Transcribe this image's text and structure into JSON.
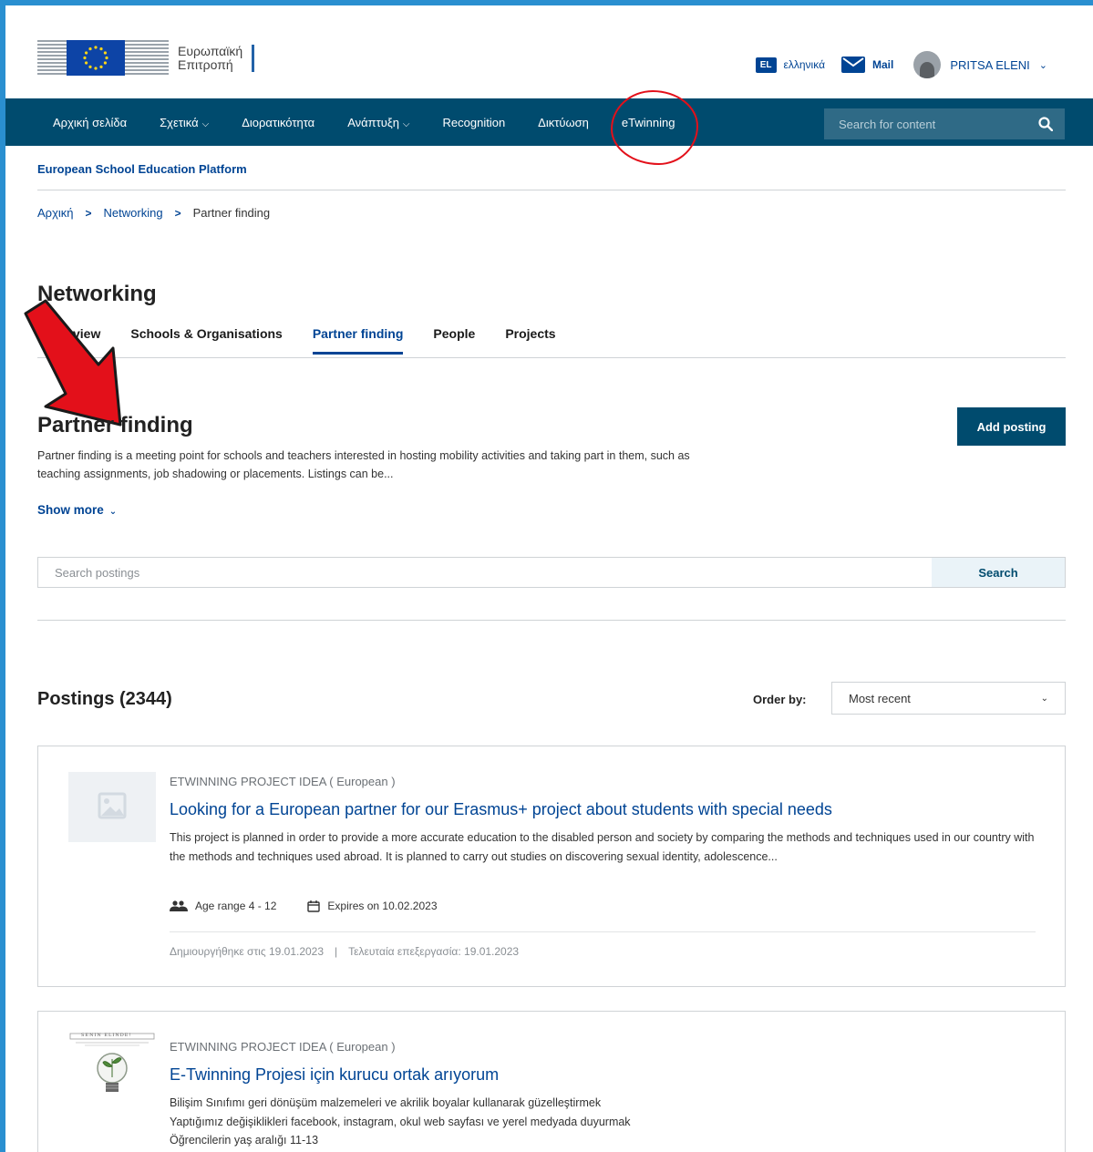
{
  "header": {
    "logo_line1": "Ευρωπαϊκή",
    "logo_line2": "Επιτροπή",
    "lang_code": "EL",
    "lang_label": "ελληνικά",
    "mail_label": "Mail",
    "user_name": "PRITSA ELENI"
  },
  "nav": {
    "items": [
      {
        "label": "Αρχική σελίδα",
        "dropdown": false
      },
      {
        "label": "Σχετικά",
        "dropdown": true
      },
      {
        "label": "Διορατικότητα",
        "dropdown": false
      },
      {
        "label": "Ανάπτυξη",
        "dropdown": true
      },
      {
        "label": "Recognition",
        "dropdown": false
      },
      {
        "label": "Δικτύωση",
        "dropdown": false
      },
      {
        "label": "eTwinning",
        "dropdown": false
      }
    ],
    "search_placeholder": "Search for content"
  },
  "platform_title": "European School Education Platform",
  "breadcrumb": [
    "Αρχική",
    "Networking",
    "Partner finding"
  ],
  "section": {
    "title": "Networking",
    "tabs": [
      "Overview",
      "Schools & Organisations",
      "Partner finding",
      "People",
      "Projects"
    ],
    "tab_visible_text": [
      "view",
      "Schools & Organisations",
      "Partner finding",
      "People",
      "Projects"
    ],
    "active_tab": "Partner finding"
  },
  "partner_finding": {
    "title": "Partner finding",
    "add_button": "Add posting",
    "description": "Partner finding is a meeting point for schools and teachers interested in hosting mobility activities and taking part in them, such as teaching assignments, job shadowing or placements. Listings can be...",
    "show_more": "Show more",
    "search_placeholder": "Search postings",
    "search_button": "Search"
  },
  "postings": {
    "title": "Postings (2344)",
    "order_label": "Order by:",
    "order_value": "Most recent",
    "items": [
      {
        "type": "ETWINNING PROJECT IDEA ( European )",
        "title": "Looking for a European partner for our Erasmus+ project about students with special needs",
        "body": "This project is planned in order to provide a more accurate education to the disabled person and society by comparing the methods and techniques used in our country with the methods and techniques used abroad. It is planned to carry out studies on discovering sexual identity, adolescence...",
        "age_range": "Age range 4 - 12",
        "expires": "Expires on 10.02.2023",
        "created": "Δημιουργήθηκε στις 19.01.2023",
        "edited": "Τελευταία επεξεργασία: 19.01.2023"
      },
      {
        "type": "ETWINNING PROJECT IDEA ( European )",
        "title": "E-Twinning Projesi için kurucu ortak arıyorum",
        "body_lines": [
          "Bilişim Sınıfımı geri dönüşüm malzemeleri ve akrilik boyalar kullanarak güzelleştirmek",
          "Yaptığımız değişiklikleri facebook, instagram, okul web sayfası ve yerel medyada duyurmak",
          "Öğrencilerin yaş aralığı 11-13"
        ],
        "thumb_caption": "SENIN ELINDE!"
      }
    ]
  },
  "colors": {
    "navbar": "#004b6e",
    "link_blue": "#004494",
    "annotation_red": "#e3101a"
  }
}
